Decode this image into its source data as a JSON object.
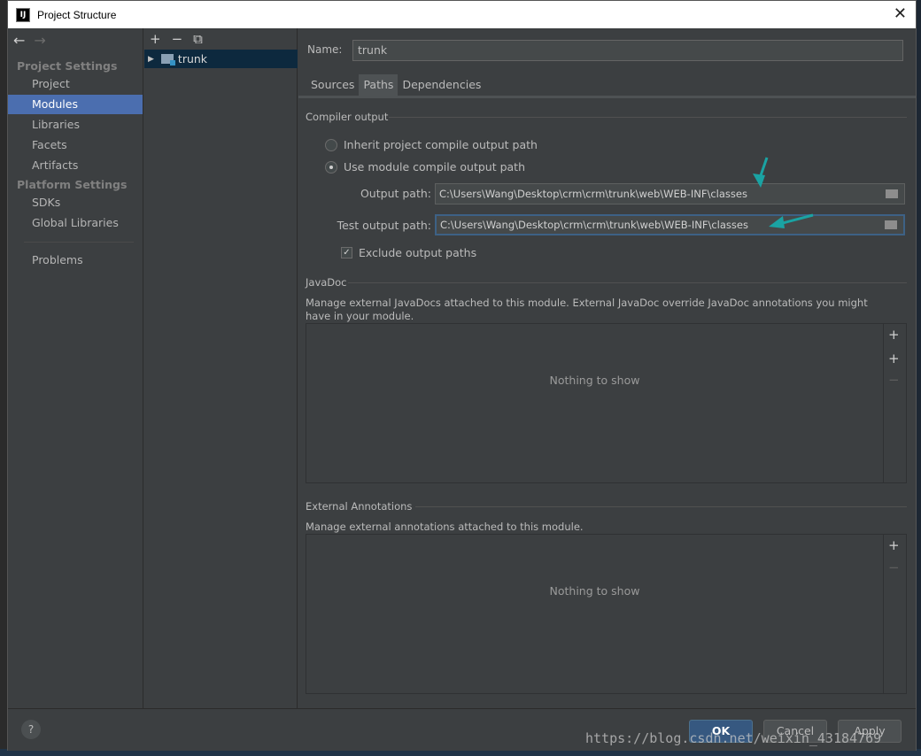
{
  "window": {
    "title": "Project Structure",
    "app_icon": "IJ"
  },
  "nav": {
    "project_settings_header": "Project Settings",
    "platform_settings_header": "Platform Settings",
    "items": [
      {
        "label": "Project"
      },
      {
        "label": "Modules"
      },
      {
        "label": "Libraries"
      },
      {
        "label": "Facets"
      },
      {
        "label": "Artifacts"
      },
      {
        "label": "SDKs"
      },
      {
        "label": "Global Libraries"
      },
      {
        "label": "Problems"
      }
    ],
    "active": "Modules"
  },
  "tree": {
    "tools": [
      "+",
      "−",
      "⧉"
    ],
    "module": "trunk"
  },
  "main": {
    "name_label": "Name:",
    "name_value": "trunk",
    "tabs": [
      "Sources",
      "Paths",
      "Dependencies"
    ],
    "active_tab": "Paths",
    "compiler_output": {
      "title": "Compiler output",
      "inherit_label": "Inherit project compile output path",
      "module_label": "Use module compile output path",
      "selected": "module",
      "output_label": "Output path:",
      "output_value": "C:\\Users\\Wang\\Desktop\\crm\\crm\\trunk\\web\\WEB-INF\\classes",
      "test_label": "Test output path:",
      "test_value": "C:\\Users\\Wang\\Desktop\\crm\\crm\\trunk\\web\\WEB-INF\\classes",
      "exclude_label": "Exclude output paths",
      "exclude_checked": true
    },
    "javadoc": {
      "title": "JavaDoc",
      "description": "Manage external JavaDocs attached to this module. External JavaDoc override JavaDoc annotations you might have in your module.",
      "empty": "Nothing to show"
    },
    "annotations": {
      "title": "External Annotations",
      "description": "Manage external annotations attached to this module.",
      "empty": "Nothing to show"
    }
  },
  "buttons": {
    "help": "?",
    "ok": "OK",
    "cancel": "Cancel",
    "apply": "Apply"
  },
  "watermark": "https://blog.csdn.net/weixin_43184769",
  "colors": {
    "accent": "#4b6eaf",
    "arrow": "#1aa3a3",
    "primary_button": "#365880"
  }
}
